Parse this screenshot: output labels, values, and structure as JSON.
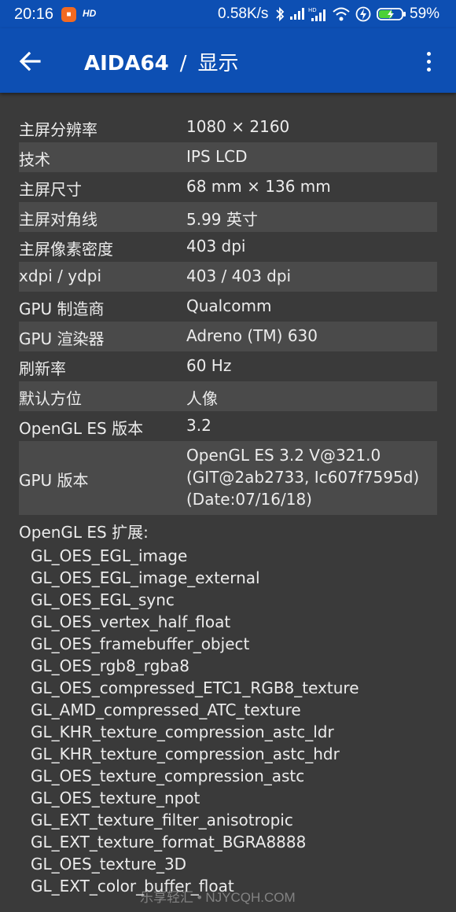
{
  "status_bar": {
    "time": "20:16",
    "hd_label": "HD",
    "net_speed": "0.58K/s",
    "battery_pct": "59%",
    "icons": [
      "app-notification-icon",
      "bluetooth-icon",
      "signal-icon",
      "signal-hd-icon",
      "wifi-icon",
      "charging-icon",
      "battery-icon"
    ]
  },
  "app_bar": {
    "app_name": "AIDA64",
    "separator": "/",
    "page": "显示",
    "accent_color": "#0d4fb3"
  },
  "properties": [
    {
      "label": "主屏分辨率",
      "value": "1080 × 2160"
    },
    {
      "label": "技术",
      "value": "IPS LCD"
    },
    {
      "label": "主屏尺寸",
      "value": "68 mm × 136 mm"
    },
    {
      "label": "主屏对角线",
      "value": "5.99 英寸"
    },
    {
      "label": "主屏像素密度",
      "value": "403 dpi"
    },
    {
      "label": "xdpi / ydpi",
      "value": "403 / 403 dpi"
    },
    {
      "label": "GPU 制造商",
      "value": "Qualcomm"
    },
    {
      "label": "GPU 渲染器",
      "value": "Adreno (TM) 630"
    },
    {
      "label": "刷新率",
      "value": "60 Hz"
    },
    {
      "label": "默认方位",
      "value": "人像"
    },
    {
      "label": "OpenGL ES 版本",
      "value": "3.2"
    }
  ],
  "gpu_version": {
    "label": "GPU 版本",
    "lines": [
      "OpenGL ES 3.2 V@321.0",
      "(GIT@2ab2733, Ic607f7595d)",
      "(Date:07/16/18)"
    ]
  },
  "extensions": {
    "heading": "OpenGL ES 扩展:",
    "items": [
      "GL_OES_EGL_image",
      "GL_OES_EGL_image_external",
      "GL_OES_EGL_sync",
      "GL_OES_vertex_half_float",
      "GL_OES_framebuffer_object",
      "GL_OES_rgb8_rgba8",
      "GL_OES_compressed_ETC1_RGB8_texture",
      "GL_AMD_compressed_ATC_texture",
      "GL_KHR_texture_compression_astc_ldr",
      "GL_KHR_texture_compression_astc_hdr",
      "GL_OES_texture_compression_astc",
      "GL_OES_texture_npot",
      "GL_EXT_texture_filter_anisotropic",
      "GL_EXT_texture_format_BGRA8888",
      "GL_OES_texture_3D",
      "GL_EXT_color_buffer_float"
    ]
  },
  "watermark": "乐享轻汇 • NJYCQH.COM"
}
